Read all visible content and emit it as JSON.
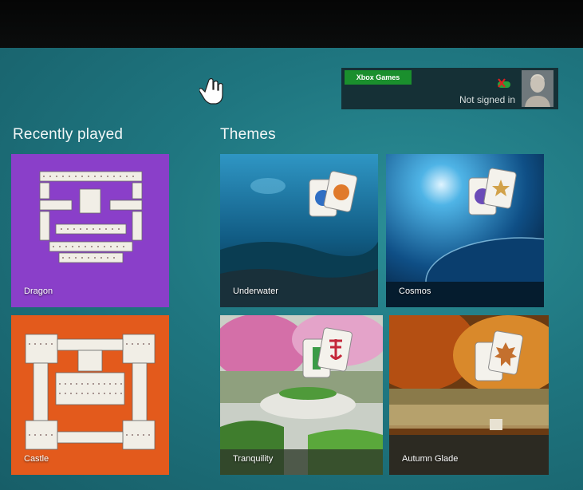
{
  "account": {
    "badge_label": "Xbox Games",
    "status": "Not signed in",
    "controller_icon": "controller-disconnected-icon",
    "avatar_icon": "user-avatar-icon"
  },
  "cursor_icon": "hand-pointer-icon",
  "recent": {
    "title": "Recently played",
    "tiles": [
      {
        "label": "Dragon",
        "color": "#8a3fc9"
      },
      {
        "label": "Castle",
        "color": "#e35a1c"
      }
    ]
  },
  "themes": {
    "title": "Themes",
    "tiles": [
      {
        "label": "Underwater"
      },
      {
        "label": "Cosmos"
      },
      {
        "label": "Tranquility"
      },
      {
        "label": "Autumn Glade"
      }
    ]
  },
  "colors": {
    "background": "#1f7680",
    "xbox_green": "#1a8f2d"
  }
}
